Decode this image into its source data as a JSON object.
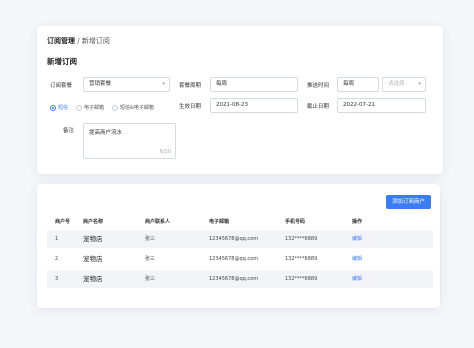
{
  "breadcrumb": {
    "main": "订阅管理",
    "sep": "/",
    "sub": "新增订阅"
  },
  "section_title": "新增订阅",
  "form": {
    "plan_label": "订阅套餐",
    "plan_value": "营销套餐",
    "cycle_label": "套餐周期",
    "cycle_value": "每周",
    "push_label": "推送时间",
    "push_value": "每周",
    "push_select_placeholder": "请选择",
    "effective_label": "生效日期",
    "effective_value": "2021-08-23",
    "deadline_label": "截止日期",
    "deadline_value": "2022-07-21",
    "channels": [
      {
        "label": "短信",
        "active": true
      },
      {
        "label": "电子邮箱",
        "active": false
      },
      {
        "label": "短信&电子邮箱",
        "active": false
      }
    ],
    "remark_label": "备注",
    "remark_value": "提高商户流水",
    "remark_count": "6/20"
  },
  "table": {
    "add_button": "添加订阅商户",
    "headers": [
      "商户号",
      "商户名称",
      "商户联系人",
      "电子邮箱",
      "手机号码",
      "操作"
    ],
    "rows": [
      {
        "id": "1",
        "name": "宠物店",
        "contact": "张三",
        "email": "12345678@qq.com",
        "phone": "132****6889",
        "action": "编辑"
      },
      {
        "id": "2",
        "name": "宠物店",
        "contact": "张三",
        "email": "12345678@qq.com",
        "phone": "132****6889",
        "action": "编辑"
      },
      {
        "id": "3",
        "name": "宠物店",
        "contact": "张三",
        "email": "12345678@qq.com",
        "phone": "132****6889",
        "action": "编辑"
      }
    ]
  },
  "colors": {
    "accent": "#3a7cf4",
    "row_alt": "#f2f4f8"
  }
}
